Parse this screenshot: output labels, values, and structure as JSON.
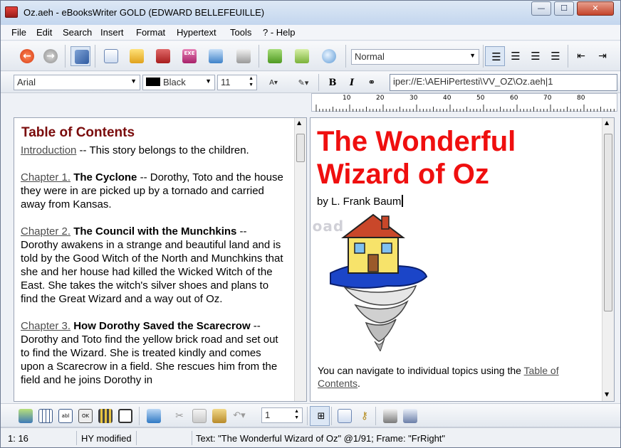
{
  "window": {
    "title": "Oz.aeh - eBooksWriter GOLD (EDWARD BELLEFEUILLE)",
    "controls": [
      "—",
      "☐",
      "✕"
    ]
  },
  "menu": [
    "File",
    "Edit",
    "Search",
    "Insert",
    "Format",
    "Hypertext",
    "Tools",
    "? - Help"
  ],
  "toolbar1": {
    "style_value": "Normal"
  },
  "toolbar2": {
    "font_value": "Arial",
    "color_value": "Black",
    "size_value": "11",
    "bold_label": "B",
    "italic_label": "I",
    "address_value": "iper://E:\\AEHiPertesti\\VV_OZ\\Oz.aeh|1"
  },
  "ruler": {
    "labels": [
      "10",
      "20",
      "30",
      "40",
      "50",
      "60",
      "70",
      "80"
    ]
  },
  "toc": {
    "title": "Table of Contents",
    "entries": [
      {
        "link": "Introduction",
        "heading": "",
        "text": " -- This story belongs to the children."
      },
      {
        "link": "Chapter 1.",
        "heading": " The Cyclone",
        "text": " -- Dorothy, Toto and the house they were in are picked up by a tornado and carried away from Kansas."
      },
      {
        "link": "Chapter 2.",
        "heading": " The Council with the Munchkins",
        "text": " -- Dorothy awakens in a strange and beautiful land and is told by the Good Witch of the North and Munchkins that she and her house had killed the Wicked Witch of the East. She takes the witch's silver shoes and plans to find the Great Wizard and a way out of Oz."
      },
      {
        "link": "Chapter 3.",
        "heading": " How Dorothy Saved the Scarecrow",
        "text": " -- Dorothy and Toto find the yellow brick road and set out to find the Wizard. She is treated kindly and comes upon a Scarecrow in a field. She rescues him from the field and he joins Dorothy in"
      }
    ]
  },
  "book": {
    "title": "The Wonderful Wizard of Oz",
    "author": "by L. Frank Baum",
    "nav_prefix": "You can navigate to individual topics using the ",
    "nav_link": "Table of Contents",
    "nav_suffix": "."
  },
  "watermark": "download",
  "bottom_toolbar": {
    "spin_value": "1"
  },
  "status": {
    "position": "1: 16",
    "modified": "HY modified",
    "info": "Text: \"The Wonderful Wizard of Oz\" @1/91; Frame: \"FrRight\""
  }
}
